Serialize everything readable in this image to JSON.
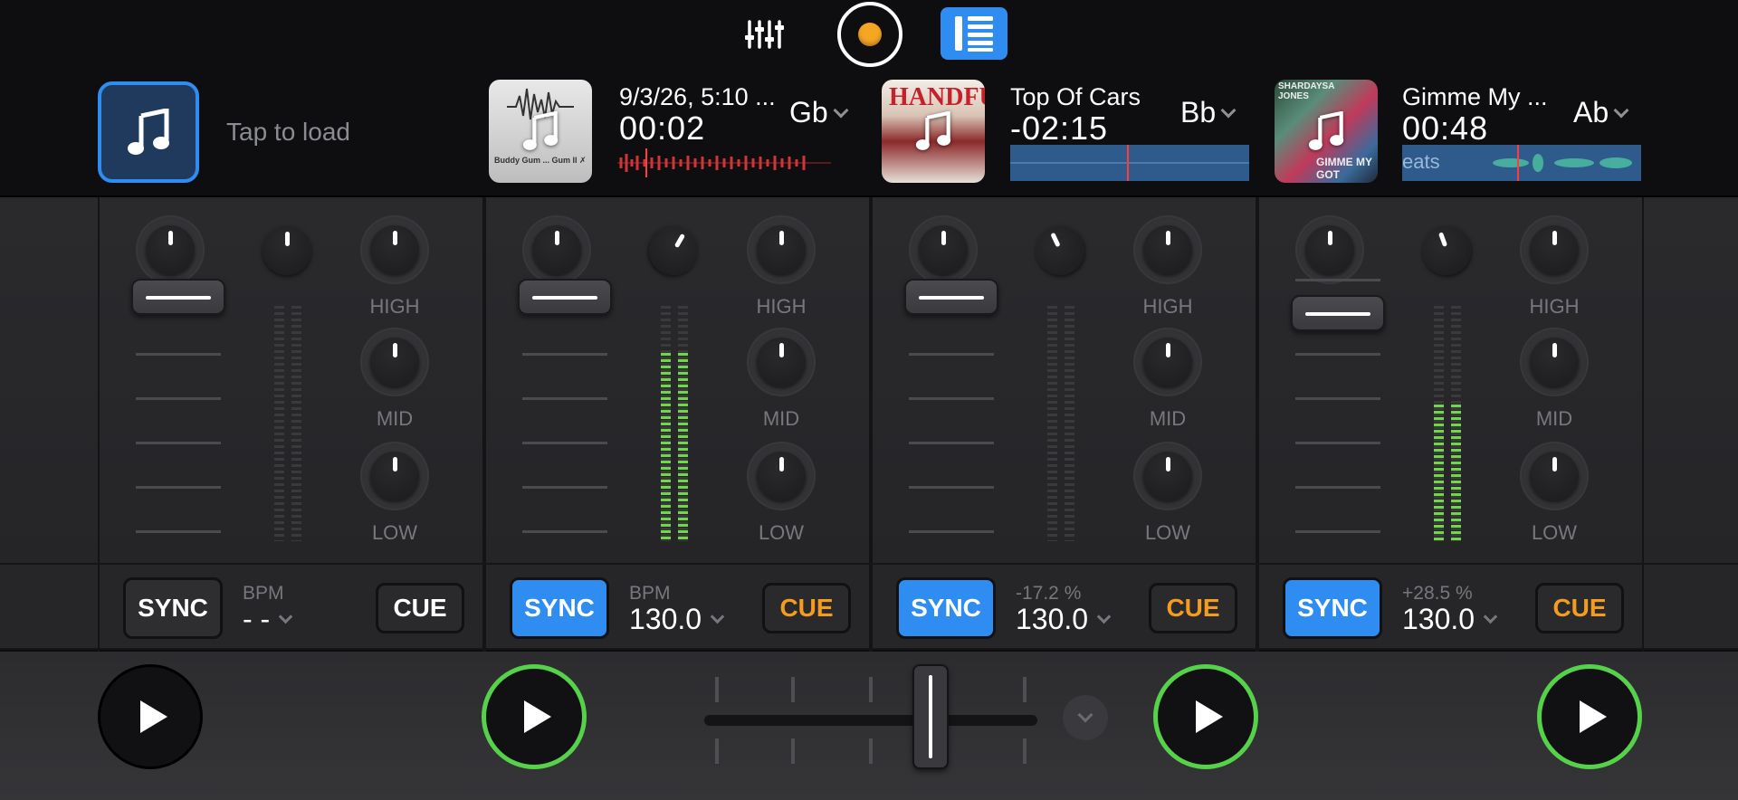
{
  "toolbar": {
    "mixer_icon": "mixer-sliders-icon",
    "record_icon": "record-icon",
    "layout_icon": "four-deck-layout-icon",
    "accent": "#2f8cf0",
    "record_color": "#f5a623"
  },
  "decks": [
    {
      "id": 1,
      "empty": true,
      "tap_to_load": "Tap to load",
      "sync_label": "SYNC",
      "sync_active": false,
      "bpm_label": "BPM",
      "bpm_value": "- -",
      "cue_label": "CUE",
      "cue_color": "#ffffff"
    },
    {
      "id": 2,
      "title": "9/3/26, 5:10 ...",
      "time": "00:02",
      "key": "Gb",
      "sync_label": "SYNC",
      "sync_active": true,
      "bpm_label": "BPM",
      "bpm_value": "130.0",
      "cue_label": "CUE",
      "cue_color": "#f39c1f",
      "art_text": "Buddy Gum ... Gum ll ✗"
    },
    {
      "id": 3,
      "title": "Top Of Cars",
      "time": "-02:15",
      "key": "Bb",
      "sync_label": "SYNC",
      "sync_active": true,
      "bpm_label": "-17.2 %",
      "bpm_value": "130.0",
      "cue_label": "CUE",
      "cue_color": "#f39c1f",
      "art_text": "HANDFUL"
    },
    {
      "id": 4,
      "title": "Gimme My ...",
      "time": "00:48",
      "key": "Ab",
      "sync_label": "SYNC",
      "sync_active": true,
      "bpm_label": "+28.5 %",
      "bpm_value": "130.0",
      "cue_label": "CUE",
      "cue_color": "#f39c1f",
      "art_text_top": "SHARDAYSA JONES",
      "art_text_bottom": "GIMME MY GOT",
      "wave_text": "eats"
    }
  ],
  "eq_labels": {
    "high": "HIGH",
    "mid": "MID",
    "low": "LOW"
  },
  "levels": {
    "deck1": 0.0,
    "deck2": 0.8,
    "deck3": 0.0,
    "deck4": 0.6
  },
  "faders": {
    "deck1": 1.0,
    "deck2": 1.0,
    "deck3": 1.0,
    "deck4": 0.78
  },
  "crossfader": {
    "position": 0.7
  },
  "colors": {
    "play_active_ring": "#55d24a",
    "meter": "#6fd848",
    "waveform_red": "#d0353a",
    "waveform_teal": "#4ab8a0",
    "waveform_bg": "#2f5a8c"
  }
}
